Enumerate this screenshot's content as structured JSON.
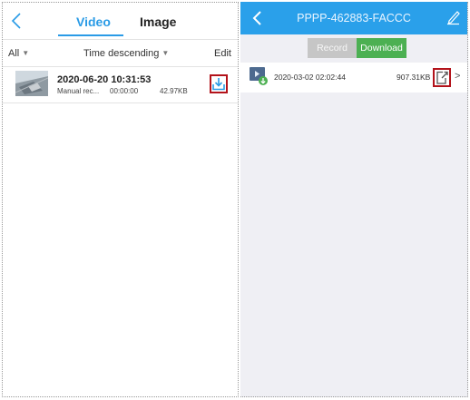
{
  "left": {
    "tabs": [
      {
        "label": "Video",
        "active": true
      },
      {
        "label": "Image",
        "active": false
      }
    ],
    "filter": {
      "all_label": "All",
      "sort_label": "Time descending",
      "edit_label": "Edit"
    },
    "items": [
      {
        "datetime": "2020-06-20 10:31:53",
        "type": "Manual rec...",
        "duration": "00:00:00",
        "size": "42.97KB"
      }
    ]
  },
  "right": {
    "title": "PPPP-462883-FACCC",
    "segments": {
      "record": "Record",
      "download": "Download",
      "active": "download"
    },
    "files": [
      {
        "date": "2020-03-02 02:02:44",
        "size": "907.31KB"
      }
    ]
  },
  "colors": {
    "accent_blue": "#2a9be6",
    "header_blue": "#2aa0ea",
    "download_green": "#4cb052",
    "highlight_red": "#b3131b"
  },
  "icons": {
    "back": "chevron-left-icon",
    "download": "download-tray-icon",
    "edit": "pencil-icon",
    "open": "open-external-icon",
    "chevron": "chevron-right-icon"
  }
}
